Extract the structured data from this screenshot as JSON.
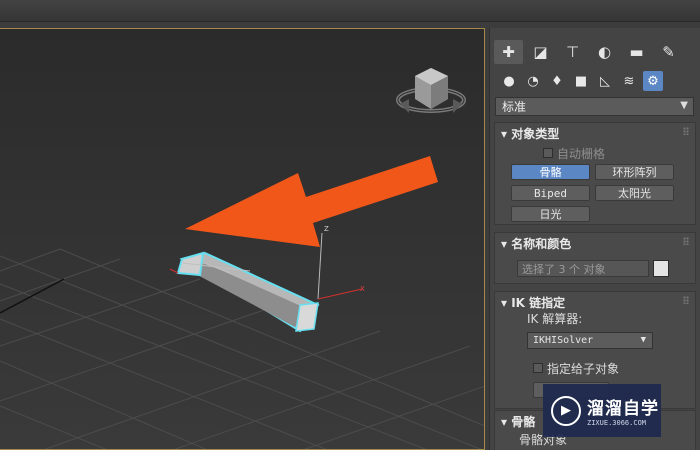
{
  "command_panel": {
    "main_tabs": [
      {
        "icon": "create-plus-icon",
        "glyph": "✚"
      },
      {
        "icon": "modify-icon",
        "glyph": "◪"
      },
      {
        "icon": "hierarchy-icon",
        "glyph": "⊤"
      },
      {
        "icon": "motion-icon",
        "glyph": "◐"
      },
      {
        "icon": "display-icon",
        "glyph": "▬"
      },
      {
        "icon": "utilities-wrench-icon",
        "glyph": "✎"
      }
    ],
    "sub_tabs": [
      {
        "icon": "geometry-sphere-icon",
        "glyph": "●"
      },
      {
        "icon": "shapes-icon",
        "glyph": "◔"
      },
      {
        "icon": "lights-icon",
        "glyph": "♦"
      },
      {
        "icon": "cameras-icon",
        "glyph": "■"
      },
      {
        "icon": "helpers-icon",
        "glyph": "◺"
      },
      {
        "icon": "space-warps-icon",
        "glyph": "≋"
      },
      {
        "icon": "systems-icon",
        "glyph": "⚙"
      }
    ],
    "category_dropdown": "标准"
  },
  "object_type": {
    "title": "对象类型",
    "autogrid_label": "自动栅格",
    "buttons": [
      "骨骼",
      "环形阵列",
      "Biped",
      "太阳光",
      "日光"
    ],
    "active_button": "骨骼"
  },
  "name_color": {
    "title": "名称和颜色",
    "name_value": "选择了 3 个 对象",
    "color": "#e3e3e3"
  },
  "ik_chain": {
    "title": "IK 链指定",
    "solver_label": "IK 解算器:",
    "solver_value": "IKHISolver",
    "assign_children_label": "指定给子对象"
  },
  "bone_params": {
    "title": "骨骼",
    "item_label": "骨骼对象"
  },
  "watermark": {
    "name": "溜溜自学",
    "url": "ZIXUE.3066.COM"
  },
  "colors": {
    "arrow": "#f2571a",
    "bone_highlight": "#66e0f0",
    "active_button": "#5b87c5"
  }
}
